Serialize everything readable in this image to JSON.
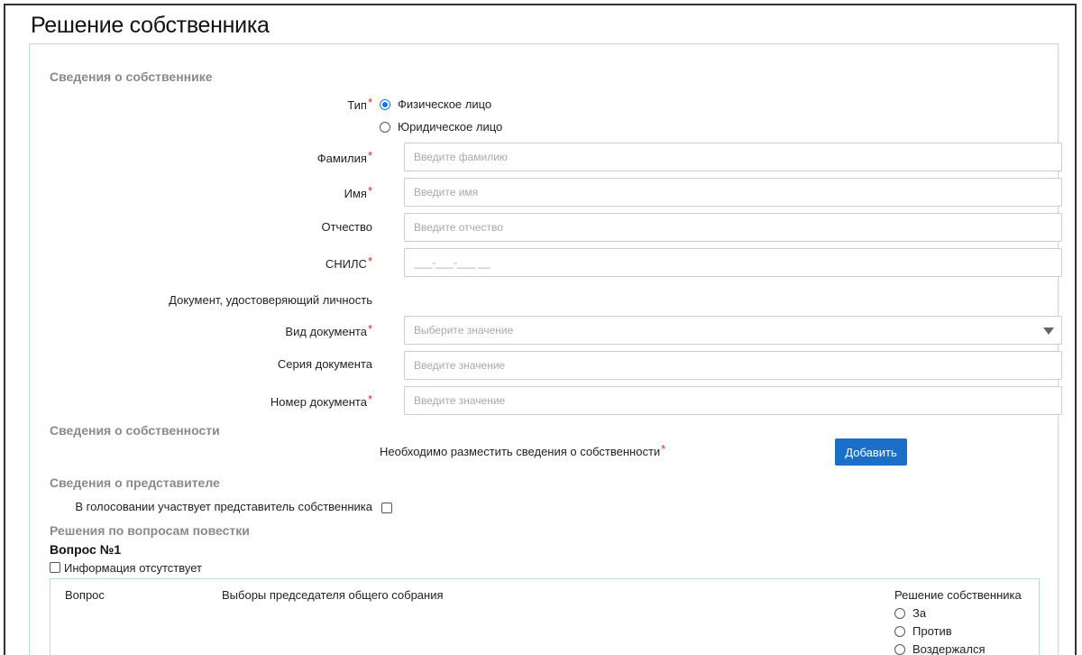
{
  "page": {
    "title": "Решение собственника"
  },
  "owner_section": {
    "title": "Сведения о собственнике",
    "type_label": "Тип",
    "type_options": [
      "Физическое лицо",
      "Юридическое лицо"
    ],
    "type_selected": "Физическое лицо",
    "surname_label": "Фамилия",
    "surname_placeholder": "Введите фамилию",
    "name_label": "Имя",
    "name_placeholder": "Введите имя",
    "patronymic_label": "Отчество",
    "patronymic_placeholder": "Введите отчество",
    "snils_label": "СНИЛС",
    "snils_placeholder": "___-___-___ __",
    "doc_heading": "Документ, удостоверяющий личность",
    "doc_type_label": "Вид документа",
    "doc_type_placeholder": "Выберите значение",
    "doc_series_label": "Серия документа",
    "doc_series_placeholder": "Введите значение",
    "doc_number_label": "Номер документа",
    "doc_number_placeholder": "Введите значение"
  },
  "property_section": {
    "title": "Сведения о собственности",
    "required_note": "Необходимо разместить сведения о собственности",
    "add_button": "Добавить"
  },
  "representative_section": {
    "title": "Сведения о представителе",
    "checkbox_label": "В голосовании участвует представитель собственника"
  },
  "agenda_section": {
    "title": "Решения по вопросам повестки",
    "question_title": "Вопрос №1",
    "no_info_label": "Информация отсутствует",
    "question_col": "Вопрос",
    "question_text": "Выборы председателя общего собрания",
    "decision_col": "Решение собственника",
    "decision_options": [
      "За",
      "Против",
      "Воздержался"
    ]
  },
  "colors": {
    "accent": "#1b6fc8",
    "required": "#d9262b",
    "panel_border": "#b9d8ec"
  }
}
